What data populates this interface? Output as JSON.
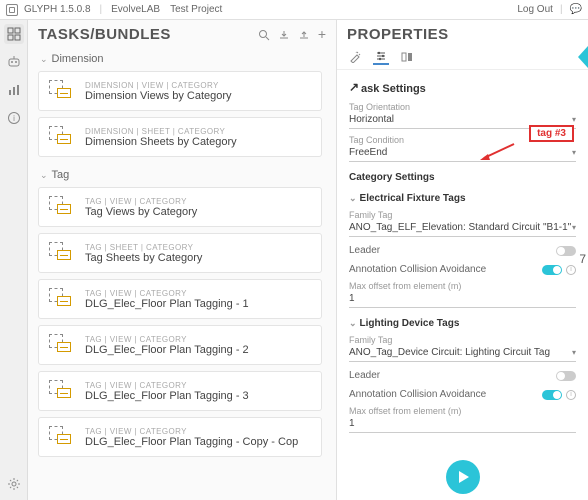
{
  "titlebar": {
    "app": "GLYPH 1.5.0.8",
    "vendor": "EvolveLAB",
    "project": "Test Project",
    "logout": "Log Out"
  },
  "tasks": {
    "heading": "TASKS/BUNDLES",
    "groups": [
      {
        "name": "Dimension",
        "items": [
          {
            "crumb": "DIMENSION  |  VIEW  |  CATEGORY",
            "title": "Dimension Views by Category"
          },
          {
            "crumb": "DIMENSION  |  SHEET  |  CATEGORY",
            "title": "Dimension Sheets by Category"
          }
        ]
      },
      {
        "name": "Tag",
        "items": [
          {
            "crumb": "TAG  |  VIEW  |  CATEGORY",
            "title": "Tag Views by Category"
          },
          {
            "crumb": "TAG  |  SHEET  |  CATEGORY",
            "title": "Tag Sheets by Category"
          },
          {
            "crumb": "TAG  |  VIEW  |  CATEGORY",
            "title": "DLG_Elec_Floor Plan Tagging - 1"
          },
          {
            "crumb": "TAG  |  VIEW  |  CATEGORY",
            "title": "DLG_Elec_Floor Plan Tagging - 2"
          },
          {
            "crumb": "TAG  |  VIEW  |  CATEGORY",
            "title": "DLG_Elec_Floor Plan Tagging - 3"
          },
          {
            "crumb": "TAG  |  VIEW  |  CATEGORY",
            "title": "DLG_Elec_Floor Plan Tagging - Copy - Cop"
          }
        ]
      }
    ]
  },
  "props": {
    "heading": "PROPERTIES",
    "task_settings_label": "ask Settings",
    "orientation_label": "Tag Orientation",
    "orientation_value": "Horizontal",
    "condition_label": "Tag Condition",
    "condition_value": "FreeEnd",
    "cat_settings_label": "Category Settings",
    "annotation_box": "tag #3",
    "cats": [
      {
        "name": "Electrical Fixture Tags",
        "family_label": "Family Tag",
        "family_value": "ANO_Tag_ELF_Elevation: Standard Circuit \"B1-1\"",
        "leader_label": "Leader",
        "leader_on": false,
        "aca_label": "Annotation Collision Avoidance",
        "aca_on": true,
        "offset_label": "Max offset from element (m)",
        "offset_value": "1"
      },
      {
        "name": "Lighting Device Tags",
        "family_label": "Family Tag",
        "family_value": "ANO_Tag_Device Circuit: Lighting Circuit Tag",
        "leader_label": "Leader",
        "leader_on": false,
        "aca_label": "Annotation Collision Avoidance",
        "aca_on": true,
        "offset_label": "Max offset from element (m)",
        "offset_value": "1"
      }
    ],
    "side_num": "7"
  }
}
